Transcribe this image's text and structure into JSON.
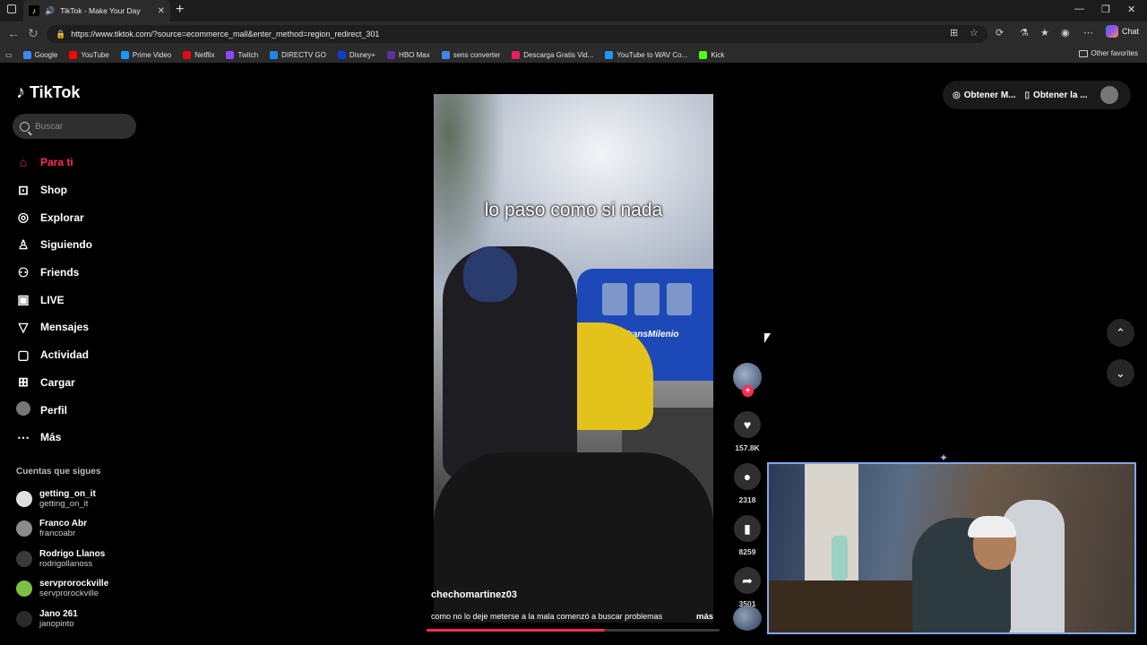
{
  "browser": {
    "tab_title": "TikTok - Make Your Day",
    "url": "https://www.tiktok.com/?source=ecommerce_mall&enter_method=region_redirect_301",
    "chat_label": "Chat",
    "bookmarks": [
      {
        "label": "Google",
        "color": "#4285f4"
      },
      {
        "label": "YouTube",
        "color": "#ff0000"
      },
      {
        "label": "Prime Video",
        "color": "#1a98ff"
      },
      {
        "label": "Netflix",
        "color": "#e50914"
      },
      {
        "label": "Twitch",
        "color": "#9146ff"
      },
      {
        "label": "DIRECTV GO",
        "color": "#1e88e5"
      },
      {
        "label": "Disney+",
        "color": "#113ccf"
      },
      {
        "label": "HBO Max",
        "color": "#5b2fa0"
      },
      {
        "label": "sens converter",
        "color": "#4285f4"
      },
      {
        "label": "Descarga Gratis Vid...",
        "color": "#e91e63"
      },
      {
        "label": "YouTube to WAV Co...",
        "color": "#2196f3"
      },
      {
        "label": "Kick",
        "color": "#53fc18"
      }
    ],
    "other_favorites": "Other favorites"
  },
  "tiktok": {
    "logo": "TikTok",
    "search_placeholder": "Buscar",
    "nav": [
      {
        "label": "Para ti",
        "icon": "home-icon",
        "active": true
      },
      {
        "label": "Shop",
        "icon": "shop-icon"
      },
      {
        "label": "Explorar",
        "icon": "compass-icon"
      },
      {
        "label": "Siguiendo",
        "icon": "following-icon"
      },
      {
        "label": "Friends",
        "icon": "friends-icon"
      },
      {
        "label": "LIVE",
        "icon": "live-icon"
      },
      {
        "label": "Mensajes",
        "icon": "messages-icon"
      },
      {
        "label": "Actividad",
        "icon": "activity-icon"
      },
      {
        "label": "Cargar",
        "icon": "upload-icon"
      },
      {
        "label": "Perfil",
        "icon": "profile-avatar"
      },
      {
        "label": "Más",
        "icon": "more-icon"
      }
    ],
    "following_title": "Cuentas que sigues",
    "following": [
      {
        "name": "getting_on_it",
        "handle": "getting_on_it",
        "color": "#e0e0e0"
      },
      {
        "name": "Franco Abr",
        "handle": "francoabr",
        "color": "#8a8a8a"
      },
      {
        "name": "Rodrigo Llanos",
        "handle": "rodrigollanoss",
        "color": "#3a3a3a"
      },
      {
        "name": "servprorockville",
        "handle": "servprorockville",
        "color": "#7cc142"
      },
      {
        "name": "Jano 261",
        "handle": "janopinto",
        "color": "#2a2a2a"
      }
    ],
    "top_right": {
      "coins": "Obtener M...",
      "app": "Obtener la ..."
    },
    "video": {
      "caption": "lo paso como si nada",
      "bus_label": "TransMilenio",
      "author": "chechomartinez03",
      "description": "como no lo deje meterse a la mala comenzó a buscar problemas",
      "more": "más",
      "progress": 0.61
    },
    "actions": {
      "likes": "157.8K",
      "comments": "2318",
      "saves": "8259",
      "shares": "3501"
    }
  }
}
